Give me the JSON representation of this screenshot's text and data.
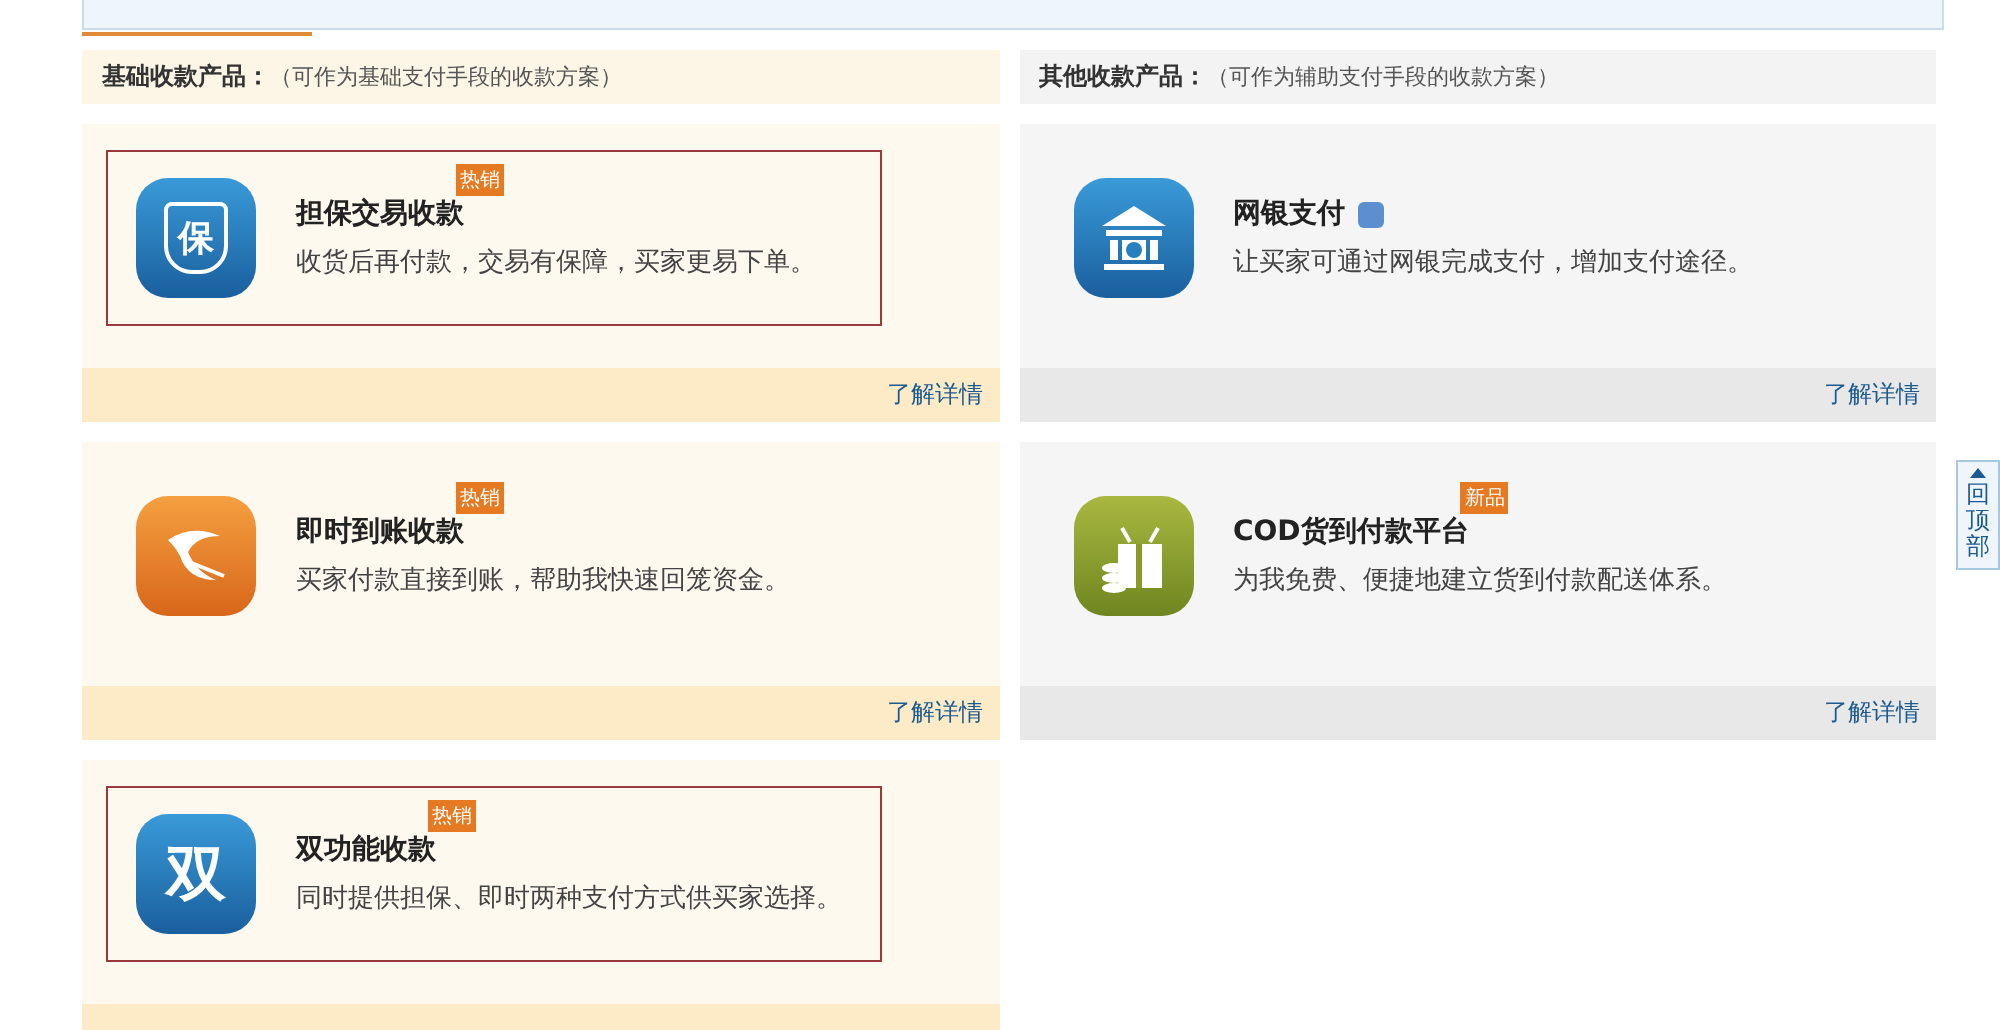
{
  "columns": [
    {
      "kind": "warm",
      "header": {
        "title": "基础收款产品：",
        "note": "（可作为基础支付手段的收款方案）"
      },
      "cards": [
        {
          "kind": "shield",
          "icon_glyph": "保",
          "title": "担保交易收款",
          "badge": "热销",
          "info": false,
          "highlighted": true,
          "description": "收货后再付款，交易有保障，买家更易下单。",
          "link": "了解详情"
        },
        {
          "kind": "bird",
          "title": "即时到账收款",
          "badge": "热销",
          "info": false,
          "highlighted": false,
          "description": "买家付款直接到账，帮助我快速回笼资金。",
          "link": "了解详情"
        },
        {
          "kind": "glyph",
          "icon_glyph": "双",
          "title": "双功能收款",
          "badge": "热销",
          "info": false,
          "highlighted": true,
          "description": "同时提供担保、即时两种支付方式供买家选择。"
        }
      ]
    },
    {
      "kind": "gray",
      "header": {
        "title": "其他收款产品：",
        "note": "（可作为辅助支付手段的收款方案）"
      },
      "cards": [
        {
          "kind": "bank",
          "title": "网银支付",
          "info": true,
          "highlighted": false,
          "description": "让买家可通过网银完成支付，增加支付途径。",
          "link": "了解详情"
        },
        {
          "kind": "gift",
          "title": "COD货到付款平台",
          "badge": "新品",
          "info": false,
          "highlighted": false,
          "description": "为我免费、便捷地建立货到付款配送体系。",
          "link": "了解详情"
        }
      ]
    }
  ],
  "back_to_top": {
    "label": "回顶部"
  }
}
